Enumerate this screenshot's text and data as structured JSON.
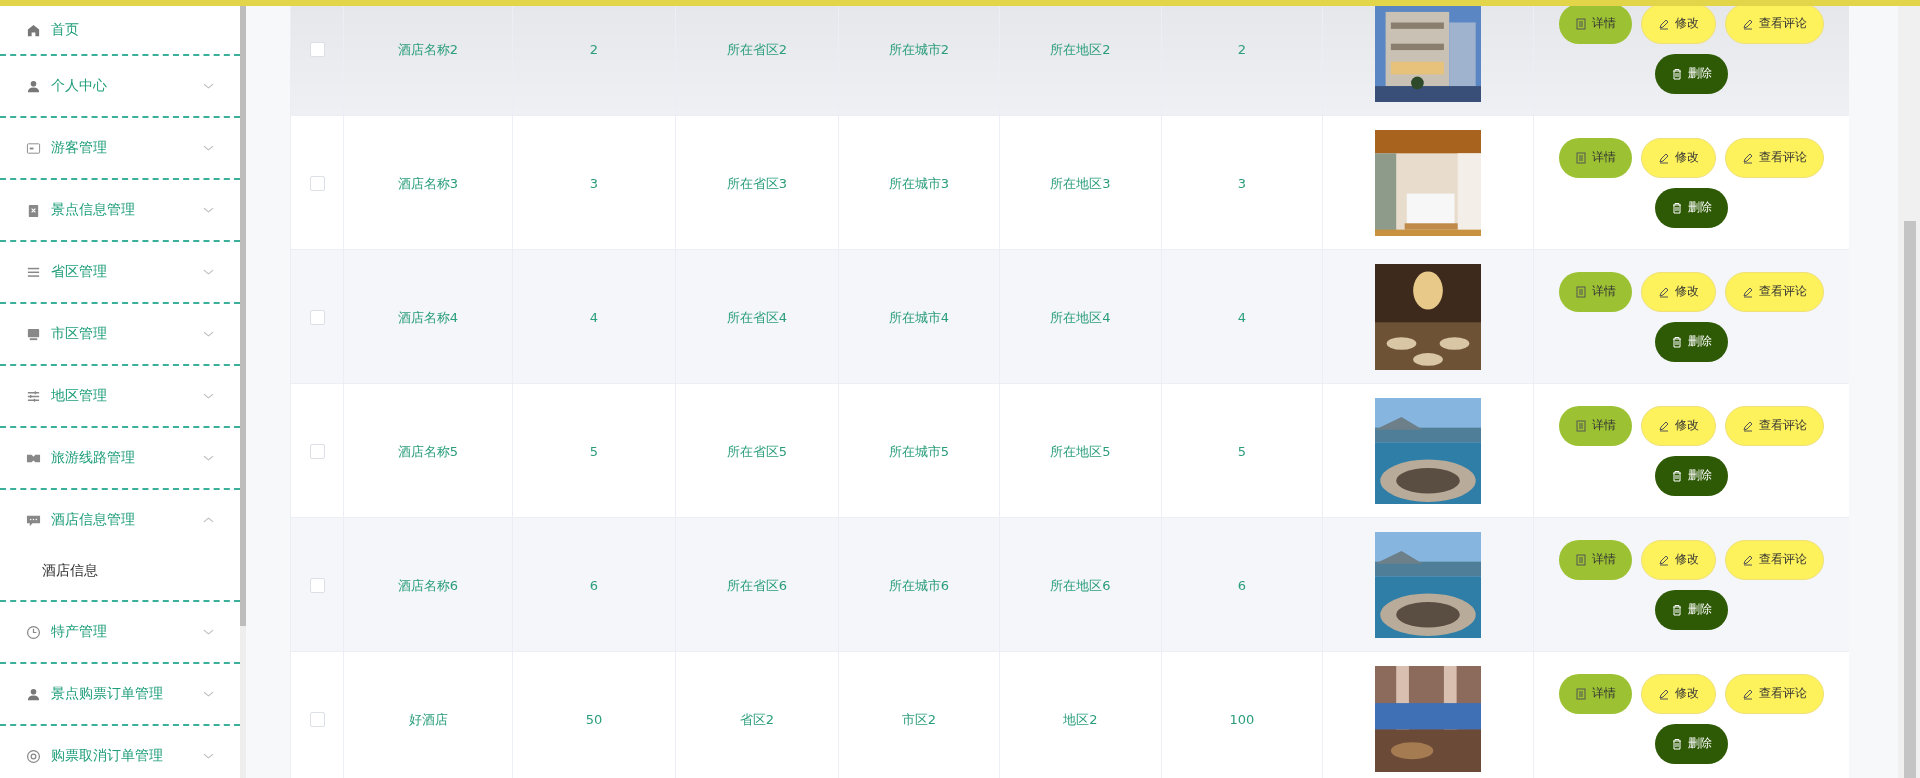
{
  "sidebar": {
    "items": [
      {
        "label": "首页",
        "has_caret": false
      },
      {
        "label": "个人中心",
        "expanded": false,
        "has_caret": true
      },
      {
        "label": "游客管理",
        "expanded": false,
        "has_caret": true
      },
      {
        "label": "景点信息管理",
        "expanded": false,
        "has_caret": true
      },
      {
        "label": "省区管理",
        "expanded": false,
        "has_caret": true
      },
      {
        "label": "市区管理",
        "expanded": false,
        "has_caret": true
      },
      {
        "label": "地区管理",
        "expanded": false,
        "has_caret": true
      },
      {
        "label": "旅游线路管理",
        "expanded": false,
        "has_caret": true
      },
      {
        "label": "酒店信息管理",
        "expanded": true,
        "has_caret": true,
        "children": [
          {
            "label": "酒店信息"
          }
        ]
      },
      {
        "label": "特产管理",
        "expanded": false,
        "has_caret": true
      },
      {
        "label": "景点购票订单管理",
        "expanded": false,
        "has_caret": true
      },
      {
        "label": "购票取消订单管理",
        "expanded": false,
        "has_caret": true
      }
    ]
  },
  "table": {
    "rows": [
      {
        "checked": false,
        "highlighted": true,
        "cells": [
          "酒店名称2",
          "2",
          "所在省区2",
          "所在城市2",
          "所在地区2",
          "2"
        ],
        "buttons": [
          "详情",
          "修改",
          "查看评论",
          "删除"
        ]
      },
      {
        "checked": false,
        "highlighted": false,
        "cells": [
          "酒店名称3",
          "3",
          "所在省区3",
          "所在城市3",
          "所在地区3",
          "3"
        ],
        "buttons": [
          "详情",
          "修改",
          "查看评论",
          "删除"
        ]
      },
      {
        "checked": false,
        "highlighted": false,
        "cells": [
          "酒店名称4",
          "4",
          "所在省区4",
          "所在城市4",
          "所在地区4",
          "4"
        ],
        "buttons": [
          "详情",
          "修改",
          "查看评论",
          "删除"
        ]
      },
      {
        "checked": false,
        "highlighted": false,
        "cells": [
          "酒店名称5",
          "5",
          "所在省区5",
          "所在城市5",
          "所在地区5",
          "5"
        ],
        "buttons": [
          "详情",
          "修改",
          "查看评论",
          "删除"
        ]
      },
      {
        "checked": false,
        "highlighted": false,
        "cells": [
          "酒店名称6",
          "6",
          "所在省区6",
          "所在城市6",
          "所在地区6",
          "6"
        ],
        "buttons": [
          "详情",
          "修改",
          "查看评论",
          "删除"
        ]
      },
      {
        "checked": false,
        "highlighted": false,
        "cells": [
          "好酒店",
          "50",
          "省区2",
          "市区2",
          "地区2",
          "100"
        ],
        "buttons": [
          "详情",
          "修改",
          "查看评论",
          "删除"
        ]
      }
    ]
  }
}
